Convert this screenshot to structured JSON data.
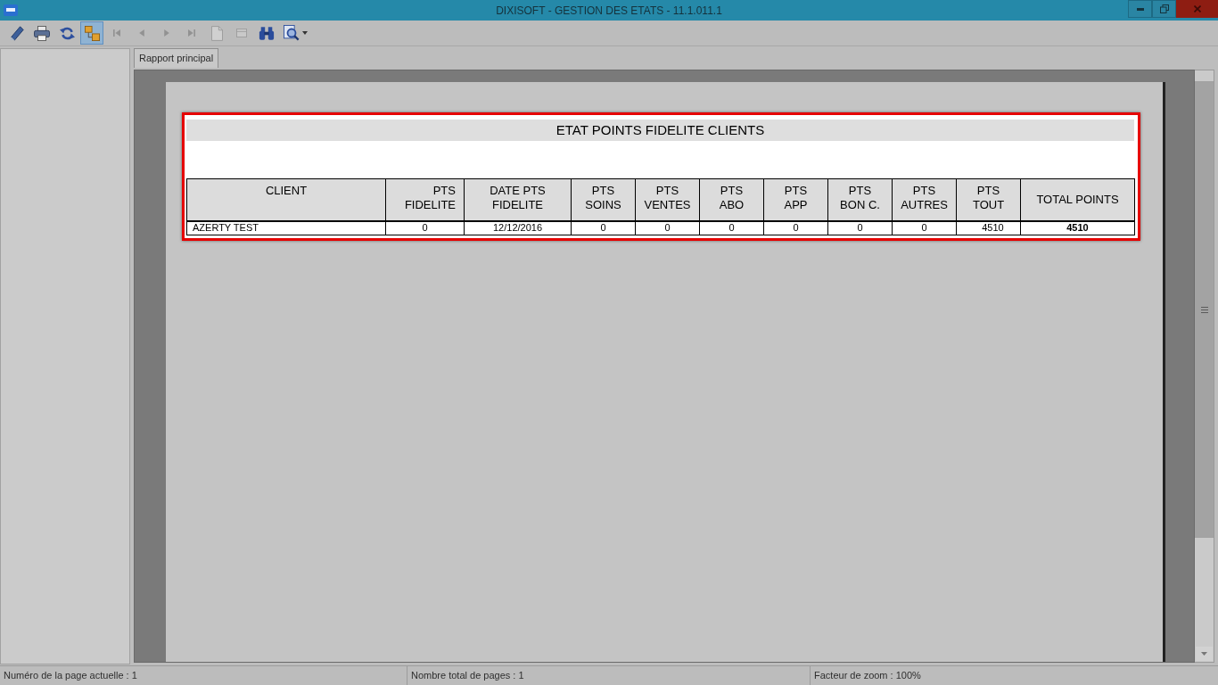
{
  "window": {
    "title": "DIXISOFT - GESTION DES ETATS - 11.1.011.1"
  },
  "toolbar": [
    {
      "selected": false,
      "disabled": false,
      "dropdown": false
    },
    {
      "selected": false,
      "disabled": false,
      "dropdown": false
    },
    {
      "selected": false,
      "disabled": false,
      "dropdown": false
    },
    {
      "selected": true,
      "disabled": false,
      "dropdown": false
    },
    {
      "selected": false,
      "disabled": true,
      "dropdown": false
    },
    {
      "selected": false,
      "disabled": true,
      "dropdown": false
    },
    {
      "selected": false,
      "disabled": true,
      "dropdown": false
    },
    {
      "selected": false,
      "disabled": true,
      "dropdown": false
    },
    {
      "selected": false,
      "disabled": true,
      "dropdown": false
    },
    {
      "selected": false,
      "disabled": true,
      "dropdown": false
    },
    {
      "selected": false,
      "disabled": false,
      "dropdown": false
    },
    {
      "selected": false,
      "disabled": false,
      "dropdown": true
    }
  ],
  "tabs": [
    {
      "label": "Rapport principal",
      "selected": true
    }
  ],
  "report": {
    "highlighted": true,
    "title": "ETAT POINTS FIDELITE CLIENTS",
    "table": {
      "columns": [
        "CLIENT",
        "PTS\nFIDELITE",
        "DATE PTS\nFIDELITE",
        "PTS\nSOINS",
        "PTS\nVENTES",
        "PTS\nABO",
        "PTS\nAPP",
        "PTS\nBON C.",
        "PTS\nAUTRES",
        "PTS\nTOUT",
        "TOTAL POINTS"
      ],
      "rows": [
        [
          "AZERTY TEST",
          "0",
          "12/12/2016",
          "0",
          "0",
          "0",
          "0",
          "0",
          "0",
          "4510",
          "4510"
        ]
      ]
    }
  },
  "status_bar": [
    "Numéro de la page actuelle : 1",
    "Nombre total de pages : 1",
    "Facteur de zoom : 100%"
  ]
}
